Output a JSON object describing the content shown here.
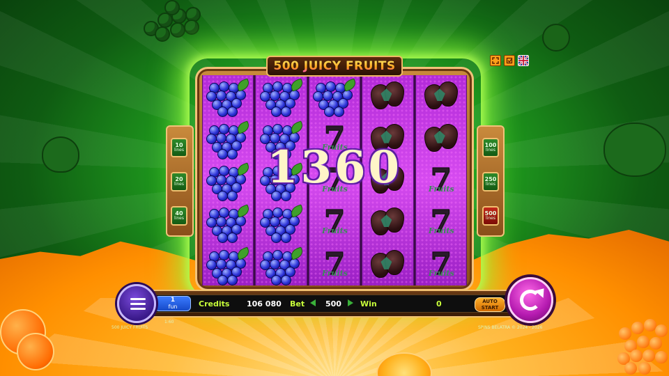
{
  "game": {
    "title": "500 JUICY FRUITS",
    "win_amount": "1360"
  },
  "lines_left": [
    {
      "count": "10",
      "label": "lines"
    },
    {
      "count": "20",
      "label": "lines"
    },
    {
      "count": "40",
      "label": "lines"
    }
  ],
  "lines_right": [
    {
      "count": "100",
      "label": "lines"
    },
    {
      "count": "250",
      "label": "lines"
    },
    {
      "count": "500",
      "label": "lines"
    }
  ],
  "reels": [
    [
      "grapes",
      "grapes",
      "grapes",
      "grapes",
      "grapes"
    ],
    [
      "grapes",
      "grapes",
      "grapes",
      "grapes",
      "grapes"
    ],
    [
      "grapes",
      "seven",
      "seven",
      "seven",
      "seven"
    ],
    [
      "strawberry",
      "strawberry",
      "strawberry",
      "strawberry",
      "strawberry"
    ],
    [
      "strawberry",
      "strawberry",
      "seven",
      "seven",
      "seven"
    ]
  ],
  "symbols": {
    "seven_numeral": "7",
    "seven_word": "Fruits"
  },
  "bar": {
    "denomination_value": "1",
    "denomination_unit": "fun",
    "credits_label": "Credits",
    "credits_value": "106 080",
    "bet_label": "Bet",
    "bet_value": "500",
    "win_label": "Win",
    "win_value": "0",
    "auto_label_1": "AUTO",
    "auto_label_2": "START"
  },
  "footer": {
    "left_text": "500 JUICY FRUITS",
    "mini_text": "1:60",
    "right_text": "SPINS BELATRA © 2024 - 2026"
  },
  "colors": {
    "background_green": "#1f9a1e",
    "reel_purple": "#c23ae0",
    "accent_gold": "#f0c070",
    "spin_pink": "#b51ab0",
    "menu_purple": "#3a1a8a"
  },
  "icons": [
    "fullscreen-icon",
    "info-icon",
    "uk-flag-icon",
    "menu-icon",
    "spin-icon",
    "left-arrow-icon",
    "right-arrow-icon"
  ]
}
